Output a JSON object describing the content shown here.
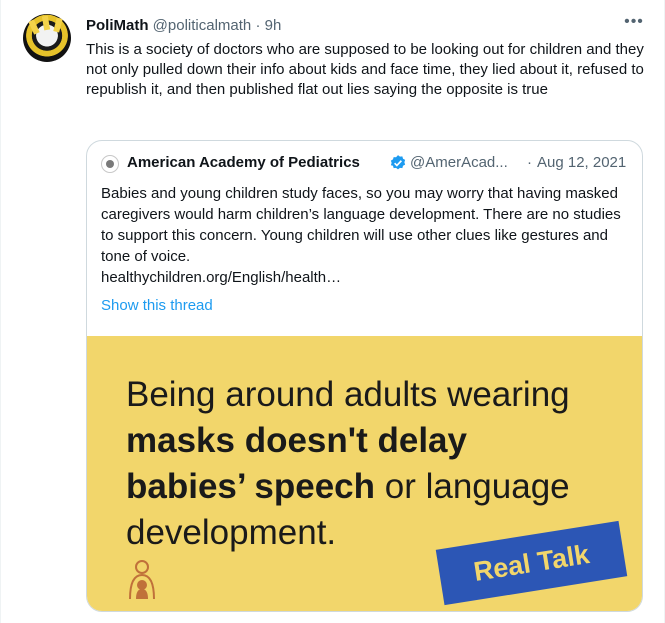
{
  "tweet": {
    "author_name": "PoliMath",
    "author_handle": "@politicalmath",
    "separator": "·",
    "time": "9h",
    "more_icon": "more-horizontal-icon",
    "text": "This is a society of doctors who are supposed to be looking out for children and they not only pulled down their info about kids and face time, they lied about it, refused to republish it, and then published flat out lies saying the opposite is true"
  },
  "quoted": {
    "author_name": "American Academy of Pediatrics",
    "author_handle": "@AmerAcad...",
    "separator": "·",
    "date": "Aug 12, 2021",
    "verified_color": "#1d9bf0",
    "text": "Babies and young children study faces, so you may worry that having masked caregivers would harm children’s language development. There are no studies to support this concern. Young children will use other clues like gestures and tone of voice.",
    "link": "healthychildren.org/English/health…",
    "show_thread": "Show this thread",
    "media": {
      "line1": "Being around adults wearing",
      "line2_bold": "masks doesn't delay",
      "line3_bold": "babies’ speech",
      "line3_rest": " or language",
      "line4": "development.",
      "badge": "Real Talk",
      "background": "#f2d66b",
      "badge_color": "#2c56b5"
    }
  }
}
